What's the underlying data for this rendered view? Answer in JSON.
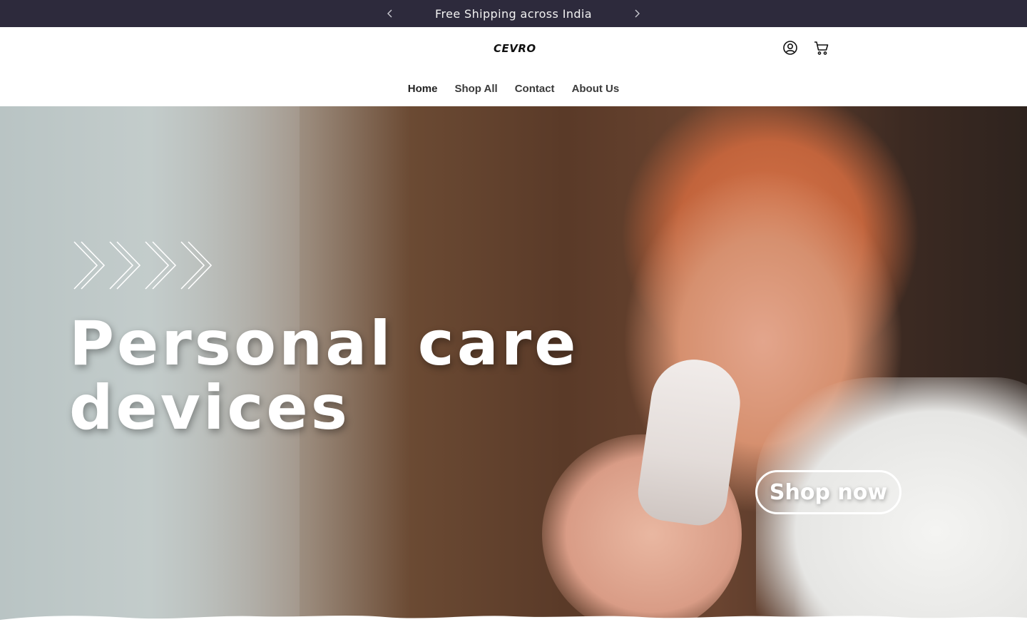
{
  "announcement": {
    "text": "Free Shipping across India",
    "prev_icon": "chevron-left-icon",
    "next_icon": "chevron-right-icon"
  },
  "header": {
    "logo_text": "CEVRO",
    "account_icon": "account-icon",
    "cart_icon": "cart-icon"
  },
  "nav": {
    "items": [
      {
        "label": "Home",
        "active": true
      },
      {
        "label": "Shop All",
        "active": false
      },
      {
        "label": "Contact",
        "active": false
      },
      {
        "label": "About Us",
        "active": false
      }
    ]
  },
  "hero": {
    "title_line1": "Personal care",
    "title_line2": "devices",
    "cta_label": "Shop now",
    "decor_icon": "chevrons-right-icon"
  },
  "colors": {
    "announcement_bg": "#2d2a3c",
    "text_light": "#ffffff",
    "nav_text": "#3a3a3a"
  }
}
